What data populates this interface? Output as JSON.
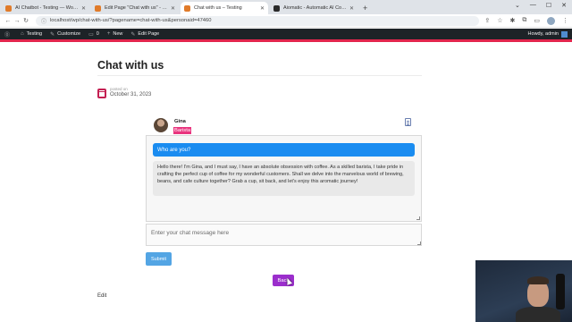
{
  "browser": {
    "tabs": [
      {
        "title": "AI Chatbot - Testing — WordPress",
        "active": false
      },
      {
        "title": "Edit Page \"Chat with us\" - Testing",
        "active": false
      },
      {
        "title": "Chat with us – Testing",
        "active": true
      },
      {
        "title": "Aiomatic - Automatic AI Content",
        "active": false
      }
    ],
    "url": "localhost/wp/chat-with-us/?pagename=chat-with-us&personaid=47460"
  },
  "admin_bar": {
    "site": "Testing",
    "customize": "Customize",
    "comments": "0",
    "new": "New",
    "edit": "Edit Page",
    "greeting": "Howdy, admin"
  },
  "page": {
    "title": "Chat with us",
    "posted_label": "posted on",
    "date": "October 31, 2023",
    "edit_link": "Edit"
  },
  "chat": {
    "persona_name": "Gina",
    "persona_role": "Barista",
    "messages": [
      {
        "role": "user",
        "text": "Who are you?"
      },
      {
        "role": "bot",
        "text": "Hello there! I'm Gina, and I must say, I have an absolute obsession with coffee. As a skilled barista, I take pride in crafting the perfect cup of coffee for my wonderful customers. Shall we delve into the marvelous world of brewing, beans, and cafe culture together? Grab a cup, sit back, and let's enjoy this aromatic journey!"
      }
    ],
    "input_placeholder": "Enter your chat message here",
    "submit_label": "Submit",
    "back_label": "Back"
  },
  "colors": {
    "user_bubble": "#1a8cf0",
    "persona_badge": "#e9347e",
    "submit": "#53a5e4",
    "back": "#9b2ecc",
    "admin_bar": "#1d2327"
  }
}
